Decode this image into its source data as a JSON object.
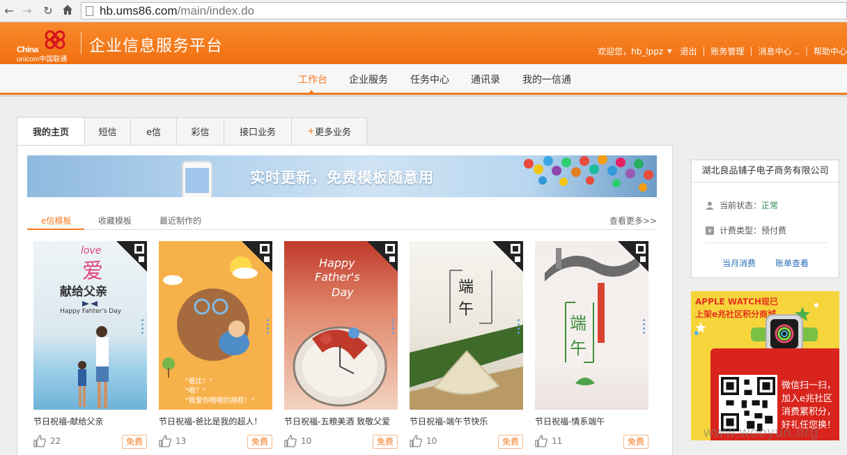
{
  "browser": {
    "url_host": "hb.ums86.com",
    "url_path": "/main/index.do"
  },
  "header": {
    "logo_text_top": "China",
    "logo_text_bottom": "unicom中国联通",
    "platform_title": "企业信息服务平台",
    "welcome": "欢迎您，hb_lppz",
    "links": [
      "退出",
      "账务管理",
      "消息中心 ..",
      "帮助中心"
    ]
  },
  "nav": {
    "items": [
      "工作台",
      "企业服务",
      "任务中心",
      "通讯录",
      "我的一信通"
    ],
    "active_index": 0
  },
  "tabs": [
    {
      "label": "我的主页",
      "active": true
    },
    {
      "label": "短信"
    },
    {
      "label": "e信"
    },
    {
      "label": "彩信"
    },
    {
      "label": "接口业务"
    },
    {
      "plus": "+",
      "label": "更多业务"
    }
  ],
  "banner": {
    "text": "实时更新，免费模板随意用"
  },
  "subtabs": {
    "items": [
      "e信模板",
      "收藏模板",
      "最近制作的"
    ],
    "active_index": 0,
    "see_more": "查看更多>>"
  },
  "cards": [
    {
      "title": "节日祝福-献给父亲",
      "likes": "22",
      "badge": "免费",
      "lines": [
        "love",
        "爱",
        "献给父亲",
        "Happy Fahter's Day"
      ]
    },
    {
      "title": "节日祝福-爸比是我的超人！",
      "likes": "13",
      "badge": "免费",
      "lines": [
        "\"爸比！\"",
        "\"嗯？\"",
        "\"我爱你哦哦的胡茬！\""
      ]
    },
    {
      "title": "节日祝福-五粮美酒 致敬父爱",
      "likes": "10",
      "badge": "免费",
      "lines": [
        "Happy",
        "Father's",
        "Day"
      ]
    },
    {
      "title": "节日祝福-端午节快乐",
      "likes": "10",
      "badge": "免费",
      "lines": [
        "端",
        "午"
      ]
    },
    {
      "title": "节日祝福-情系端午",
      "likes": "11",
      "badge": "免费",
      "lines": [
        "端",
        "午"
      ]
    }
  ],
  "company": {
    "name": "湖北良品铺子电子商务有限公司",
    "status_label": "当前状态：",
    "status_value": "正常",
    "billing_label": "计费类型：预付费",
    "links": [
      "当月消费",
      "账单查看"
    ]
  },
  "ad": {
    "line1": "APPLE WATCH现已",
    "line2": "上架e兆社区积分商城",
    "qr_text": [
      "微信扫一扫，",
      "加入e兆社区",
      "消费累积分，",
      "好礼任您换！"
    ]
  },
  "watermark": "www.wooyun.org",
  "colors": {
    "brand_orange": "#f47a20",
    "link_blue": "#2a6cb8",
    "status_green": "#2d8a4e"
  }
}
